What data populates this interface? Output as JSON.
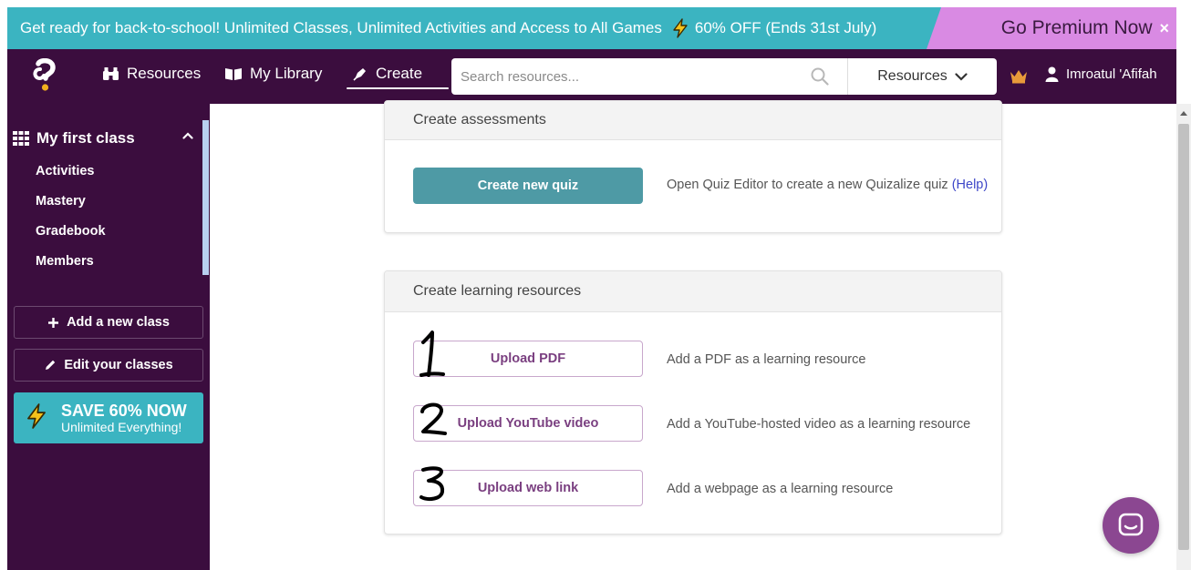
{
  "promo": {
    "text": "Get ready for back-to-school!  Unlimited Classes, Unlimited Activities and Access to All Games",
    "offer": "60% OFF (Ends 31st July)",
    "premium_label": "Go Premium Now",
    "close_glyph": "×"
  },
  "nav": {
    "resources": "Resources",
    "my_library": "My Library",
    "create": "Create",
    "search_placeholder": "Search resources...",
    "search_scope": "Resources",
    "user_name": "Imroatul 'Afifah"
  },
  "sidebar": {
    "class_name": "My first class",
    "items": [
      "Activities",
      "Mastery",
      "Gradebook",
      "Members"
    ],
    "add_class": "Add a new class",
    "edit_classes": "Edit your classes",
    "save_title": "SAVE 60% NOW",
    "save_sub": "Unlimited Everything!"
  },
  "assessments": {
    "title": "Create assessments",
    "quiz_button": "Create new quiz",
    "quiz_desc": "Open Quiz Editor to create a new Quizalize quiz",
    "help_link": "(Help)"
  },
  "learning": {
    "title": "Create learning resources",
    "rows": [
      {
        "annotation": "1",
        "button": "Upload PDF",
        "desc": "Add a PDF as a learning resource"
      },
      {
        "annotation": "2",
        "button": "Upload YouTube video",
        "desc": "Add a YouTube-hosted video as a learning resource"
      },
      {
        "annotation": "3",
        "button": "Upload web link",
        "desc": "Add a webpage as a learning resource"
      }
    ]
  },
  "colors": {
    "banner": "#3bb4c1",
    "premium": "#d98ae3",
    "nav": "#3b0d3e",
    "quiz_button": "#4e9aa5",
    "resource_text": "#7a3f80",
    "chat": "#8b4791"
  }
}
